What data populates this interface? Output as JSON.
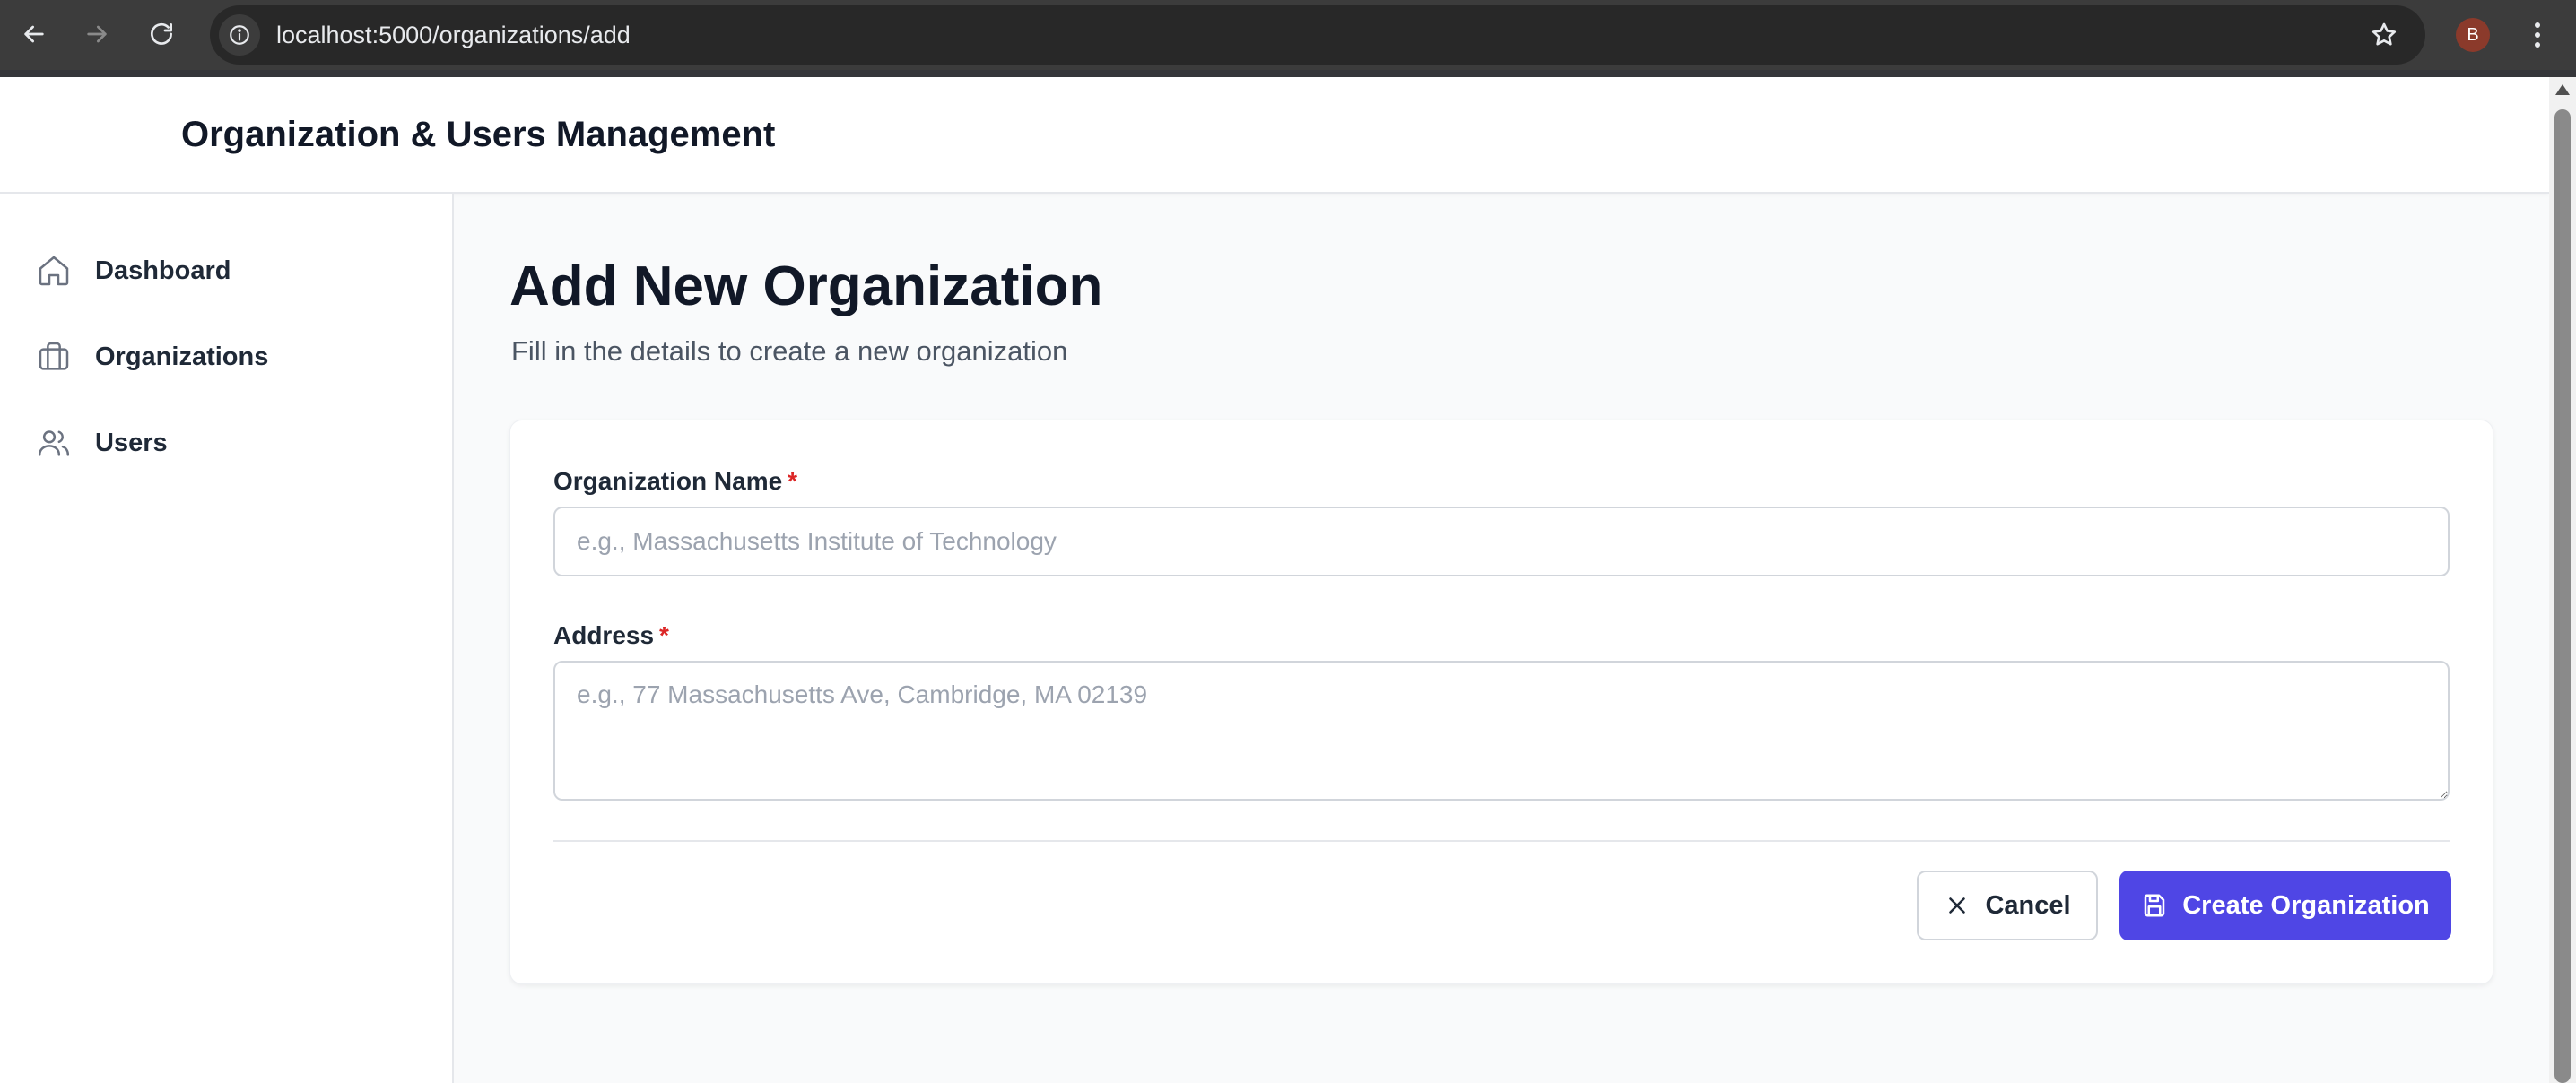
{
  "browser": {
    "url": "localhost:5000/organizations/add",
    "profile_initial": "B"
  },
  "header": {
    "title": "Organization & Users Management"
  },
  "sidebar": {
    "items": [
      {
        "label": "Dashboard",
        "icon": "home-icon"
      },
      {
        "label": "Organizations",
        "icon": "briefcase-icon"
      },
      {
        "label": "Users",
        "icon": "users-icon"
      }
    ]
  },
  "main": {
    "title": "Add New Organization",
    "subtitle": "Fill in the details to create a new organization"
  },
  "form": {
    "name_label": "Organization Name",
    "name_value": "",
    "name_placeholder": "e.g., Massachusetts Institute of Technology",
    "address_label": "Address",
    "address_value": "",
    "address_placeholder": "e.g., 77 Massachusetts Ave, Cambridge, MA 02139",
    "required_mark": "*",
    "cancel_label": "Cancel",
    "submit_label": "Create Organization"
  },
  "colors": {
    "primary": "#4f46e5",
    "required": "#dc2626",
    "chrome": "#3c3c3c"
  }
}
